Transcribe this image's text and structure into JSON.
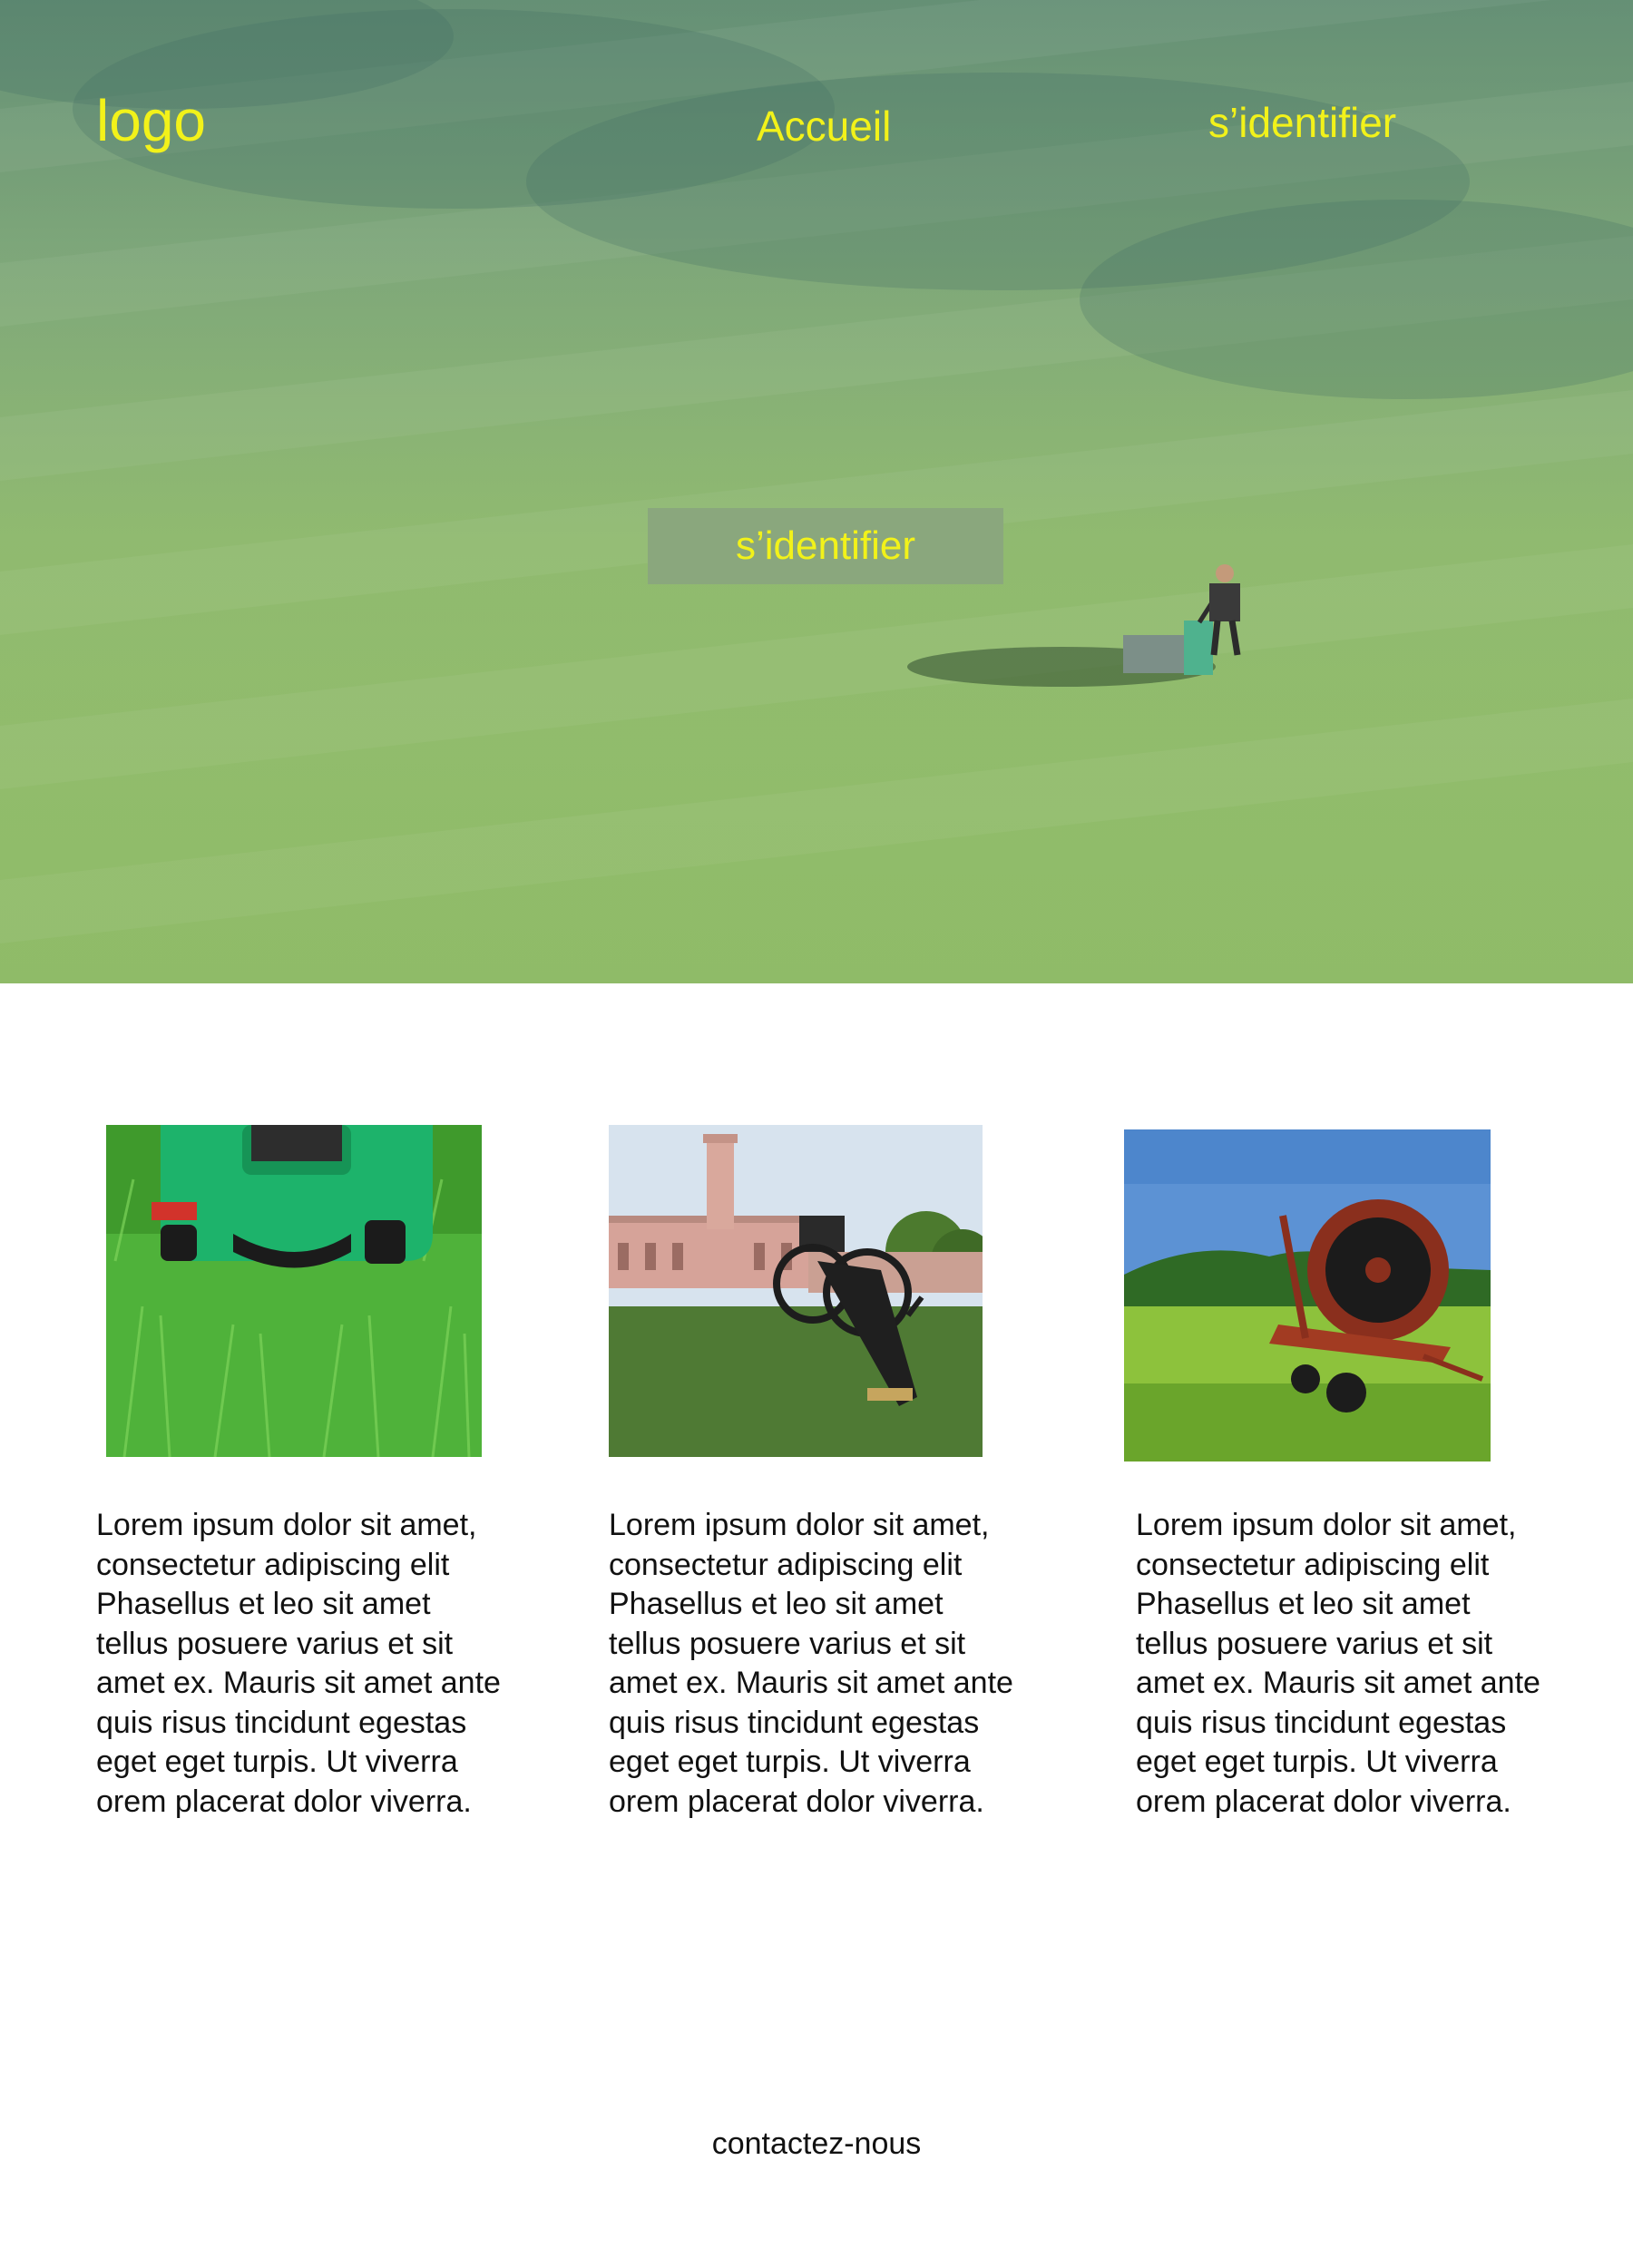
{
  "header": {
    "logo": "logo",
    "nav": {
      "home": "Accueil",
      "login": "s’identifier"
    }
  },
  "hero": {
    "cta_label": "s’identifier",
    "colors": {
      "nav_text": "#f2f21a",
      "cta_background": "#8aa77d",
      "grass": "#93bd6e"
    }
  },
  "cards": [
    {
      "image": "lawn-mower-on-grass-photo",
      "text": " Lorem ipsum dolor sit amet,\nconsectetur adipiscing elit\nPhasellus et leo sit amet\ntellus posuere varius et sit\namet ex. Mauris sit amet ante\nquis risus tincidunt egestas\neget eget turpis. Ut viverra\norem placerat dolor viverra."
    },
    {
      "image": "field-cannon-photo",
      "text": "Lorem ipsum dolor sit amet,\nconsectetur adipiscing elit\nPhasellus et leo sit amet\ntellus posuere varius et sit\namet ex. Mauris sit amet ante\nquis risus tincidunt egestas\neget eget turpis. Ut viverra\norem placerat dolor viverra."
    },
    {
      "image": "irrigation-hose-reel-photo",
      "text": "Lorem ipsum dolor sit amet,\nconsectetur adipiscing elit\nPhasellus et leo sit amet\ntellus posuere varius et sit\namet ex. Mauris sit amet ante\nquis risus tincidunt egestas\neget eget turpis. Ut viverra\norem placerat dolor viverra."
    }
  ],
  "footer": {
    "contact": "contactez-nous"
  }
}
